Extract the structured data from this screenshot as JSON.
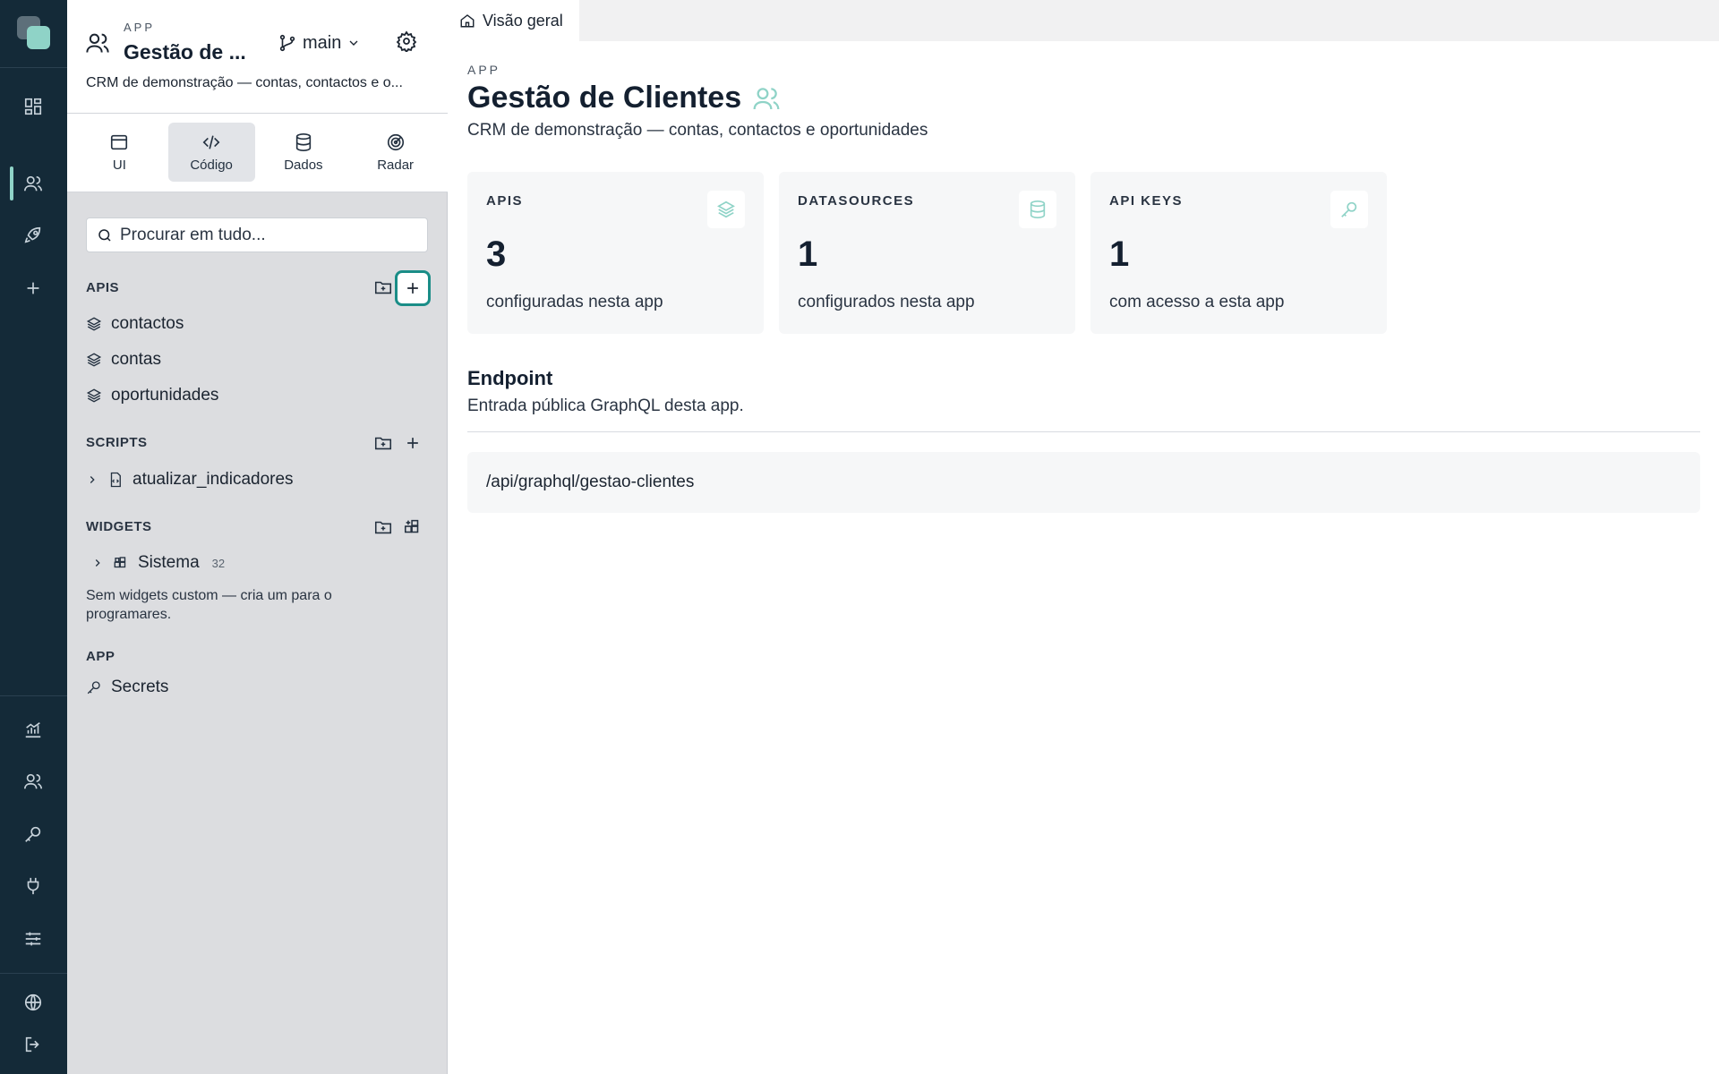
{
  "sidebar": {
    "kicker": "APP",
    "title": "Gestão de ...",
    "branch": "main",
    "description": "CRM de demonstração — contas, contactos e o...",
    "tabs": [
      {
        "label": "UI"
      },
      {
        "label": "Código"
      },
      {
        "label": "Dados"
      },
      {
        "label": "Radar"
      }
    ],
    "search_placeholder": "Procurar em tudo...",
    "apis_title": "APIS",
    "apis": [
      "contactos",
      "contas",
      "oportunidades"
    ],
    "scripts_title": "SCRIPTS",
    "scripts": [
      "atualizar_indicadores"
    ],
    "widgets_title": "WIDGETS",
    "widgets_group": "Sistema",
    "widgets_count": "32",
    "widgets_note": "Sem widgets custom — cria um para o programares.",
    "app_title": "APP",
    "app_items": [
      "Secrets"
    ]
  },
  "main": {
    "tab_label": "Visão geral",
    "kicker": "APP",
    "title": "Gestão de Clientes",
    "subtitle": "CRM de demonstração — contas, contactos e oportunidades",
    "cards": [
      {
        "title": "APIS",
        "value": "3",
        "caption": "configuradas nesta app",
        "icon": "layers-icon"
      },
      {
        "title": "DATASOURCES",
        "value": "1",
        "caption": "configurados nesta app",
        "icon": "database-icon"
      },
      {
        "title": "API KEYS",
        "value": "1",
        "caption": "com acesso a esta app",
        "icon": "key-icon"
      }
    ],
    "endpoint_title": "Endpoint",
    "endpoint_subtitle": "Entrada pública GraphQL desta app.",
    "endpoint_path": "/api/graphql/gestao-clientes"
  },
  "colors": {
    "rail": "#142a38",
    "accent": "#8fd3c7",
    "highlight": "#1a8d87",
    "sidebar": "#dcdde0"
  }
}
